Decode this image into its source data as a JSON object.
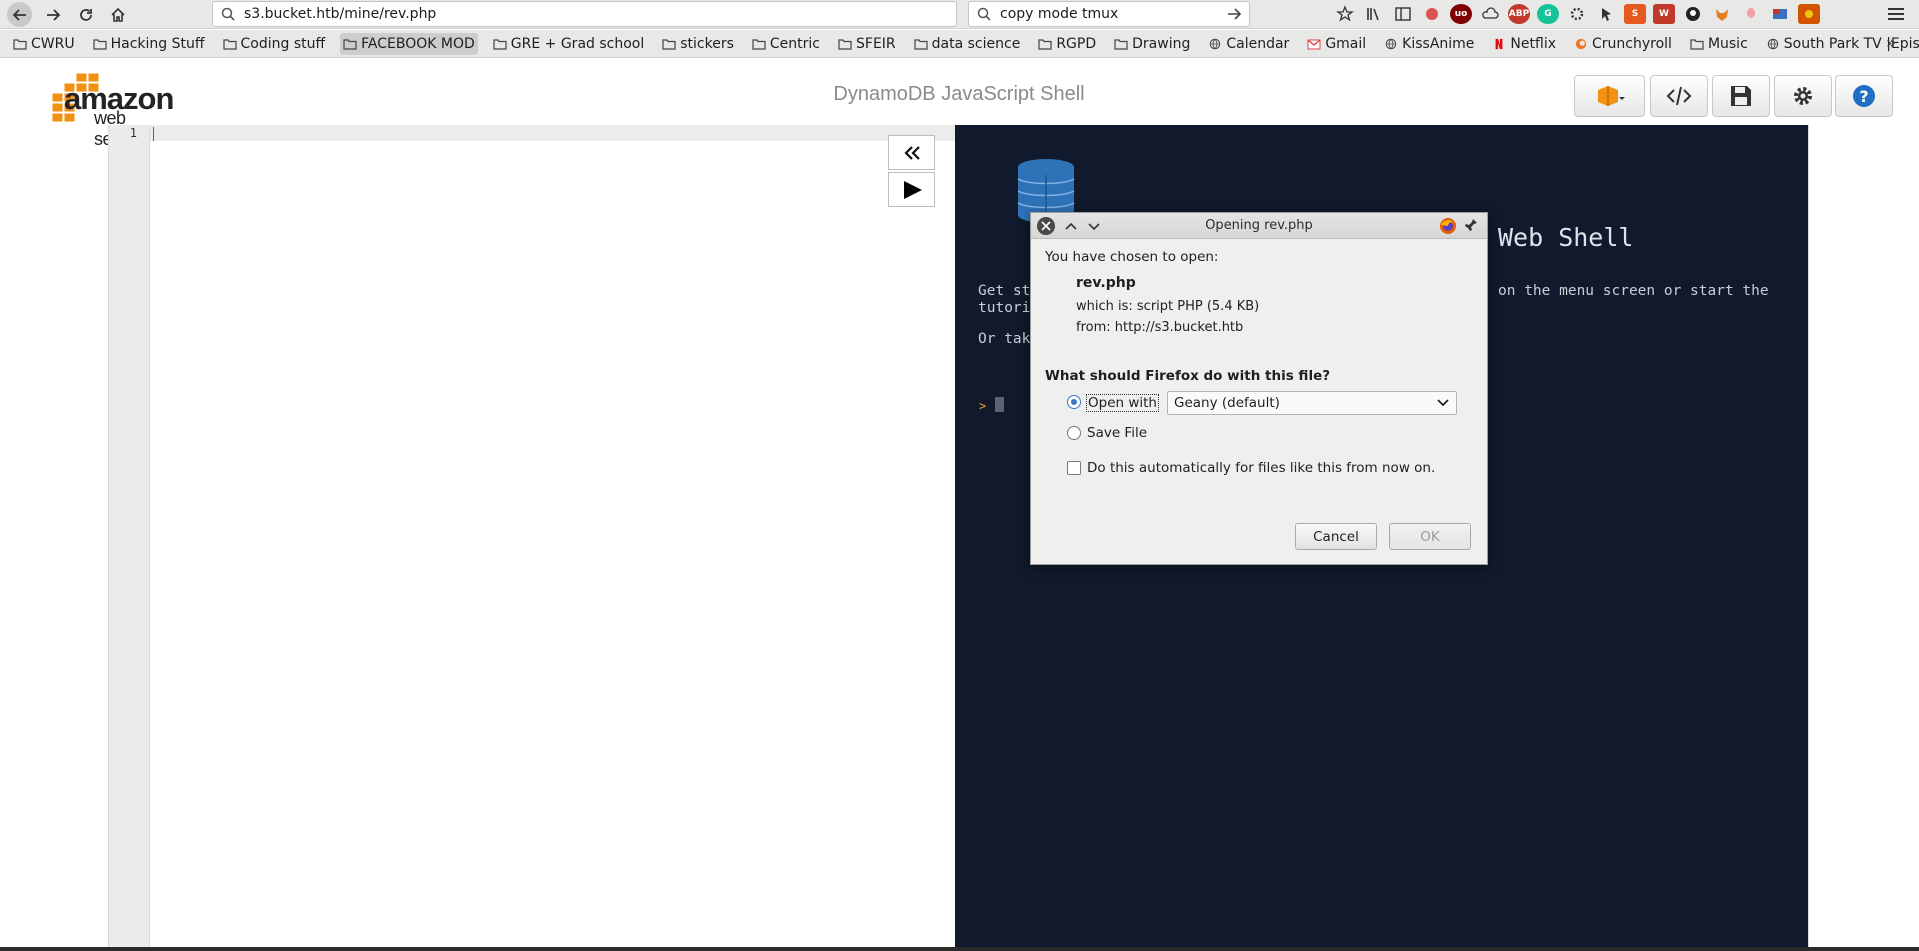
{
  "browser": {
    "url": "s3.bucket.htb/mine/rev.php",
    "search_value": "copy mode tmux"
  },
  "bookmarks": [
    {
      "label": "CWRU",
      "icon": "folder-icon"
    },
    {
      "label": "Hacking Stuff",
      "icon": "folder-icon"
    },
    {
      "label": "Coding stuff",
      "icon": "folder-icon"
    },
    {
      "label": "FACEBOOK MOD",
      "icon": "folder-icon"
    },
    {
      "label": "GRE + Grad school",
      "icon": "folder-icon"
    },
    {
      "label": "stickers",
      "icon": "folder-icon"
    },
    {
      "label": "Centric",
      "icon": "folder-icon"
    },
    {
      "label": "SFEIR",
      "icon": "folder-icon"
    },
    {
      "label": "data science",
      "icon": "folder-icon"
    },
    {
      "label": "RGPD",
      "icon": "folder-icon"
    },
    {
      "label": "Drawing",
      "icon": "folder-icon"
    },
    {
      "label": "Calendar",
      "icon": "globe-icon"
    },
    {
      "label": "Gmail",
      "icon": "gmail-icon"
    },
    {
      "label": "KissAnime",
      "icon": "globe-icon"
    },
    {
      "label": "Netflix",
      "icon": "netflix-icon"
    },
    {
      "label": "Crunchyroll",
      "icon": "crunchyroll-icon"
    },
    {
      "label": "Music",
      "icon": "folder-icon"
    },
    {
      "label": "South Park TV |Epis...",
      "icon": "globe-icon"
    }
  ],
  "app": {
    "logo_amazon": "amazon",
    "logo_webservices": "web services",
    "title": "DynamoDB JavaScript Shell"
  },
  "editor": {
    "line_number": "1"
  },
  "shell": {
    "heading": "Web Shell",
    "line1": "Get st",
    "line1_right": "on the menu screen or start the",
    "line2": "tutori",
    "line3": "Or tak",
    "prompt": ">"
  },
  "dialog": {
    "title": "Opening rev.php",
    "intro": "You have chosen to open:",
    "filename": "rev.php",
    "which_is": "which is: script PHP (5.4 KB)",
    "from": "from: http://s3.bucket.htb",
    "question": "What should Firefox do with this file?",
    "open_with_label": "Open with",
    "open_with_app": "Geany (default)",
    "save_file_label": "Save File",
    "auto_label": "Do this automatically for files like this from now on.",
    "cancel_label": "Cancel",
    "ok_label": "OK"
  },
  "colors": {
    "shell_bg": "#101a2c",
    "aws_orange": "#f29111",
    "dynamo_blue": "#2e73b8"
  }
}
